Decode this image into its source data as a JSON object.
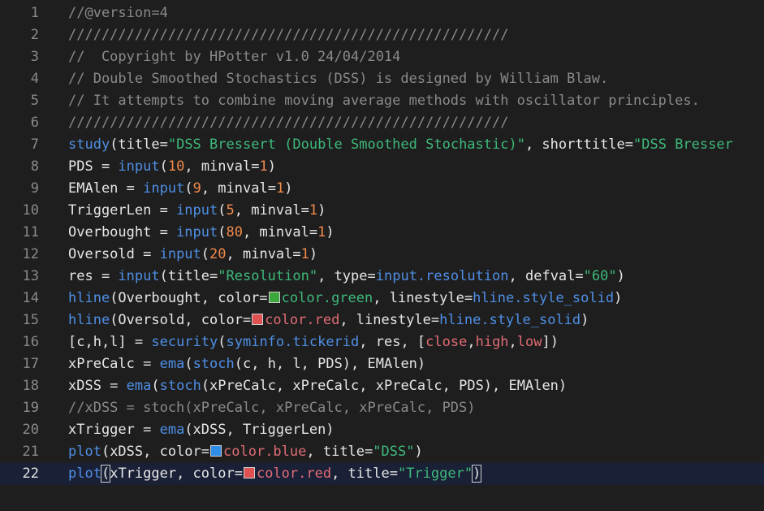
{
  "editor": {
    "active_line": 22,
    "colors": {
      "background": "#1e1e1e",
      "active_line_bg": "#1a2036",
      "comment": "#8a8a8a",
      "function": "#4f8fe6",
      "number": "#f08a4b",
      "string": "#3eb97a",
      "plain": "#e6e6e6",
      "green_swatch": "#3ca83c",
      "red_swatch": "#e05252",
      "blue_swatch": "#2f8fe8"
    },
    "lines": [
      {
        "n": "1",
        "tokens": [
          {
            "t": "comment",
            "v": "//@version=4"
          }
        ]
      },
      {
        "n": "2",
        "tokens": [
          {
            "t": "comment",
            "v": "/////////////////////////////////////////////////////"
          }
        ]
      },
      {
        "n": "3",
        "tokens": [
          {
            "t": "comment",
            "v": "//  Copyright by HPotter v1.0 24/04/2014"
          }
        ]
      },
      {
        "n": "4",
        "tokens": [
          {
            "t": "comment",
            "v": "// Double Smoothed Stochastics (DSS) is designed by William Blaw."
          }
        ]
      },
      {
        "n": "5",
        "tokens": [
          {
            "t": "comment",
            "v": "// It attempts to combine moving average methods with oscillator principles."
          }
        ]
      },
      {
        "n": "6",
        "tokens": [
          {
            "t": "comment",
            "v": "/////////////////////////////////////////////////////"
          }
        ]
      },
      {
        "n": "7",
        "tokens": [
          {
            "t": "func",
            "v": "study"
          },
          {
            "t": "plain",
            "v": "(title="
          },
          {
            "t": "str",
            "v": "\"DSS Bressert (Double Smoothed Stochastic)\""
          },
          {
            "t": "plain",
            "v": ", shorttitle="
          },
          {
            "t": "str",
            "v": "\"DSS Bresser"
          }
        ]
      },
      {
        "n": "8",
        "tokens": [
          {
            "t": "plain",
            "v": "PDS = "
          },
          {
            "t": "func",
            "v": "input"
          },
          {
            "t": "plain",
            "v": "("
          },
          {
            "t": "num",
            "v": "10"
          },
          {
            "t": "plain",
            "v": ", minval="
          },
          {
            "t": "num",
            "v": "1"
          },
          {
            "t": "plain",
            "v": ")"
          }
        ]
      },
      {
        "n": "9",
        "tokens": [
          {
            "t": "plain",
            "v": "EMAlen = "
          },
          {
            "t": "func",
            "v": "input"
          },
          {
            "t": "plain",
            "v": "("
          },
          {
            "t": "num",
            "v": "9"
          },
          {
            "t": "plain",
            "v": ", minval="
          },
          {
            "t": "num",
            "v": "1"
          },
          {
            "t": "plain",
            "v": ")"
          }
        ]
      },
      {
        "n": "10",
        "tokens": [
          {
            "t": "plain",
            "v": "TriggerLen = "
          },
          {
            "t": "func",
            "v": "input"
          },
          {
            "t": "plain",
            "v": "("
          },
          {
            "t": "num",
            "v": "5"
          },
          {
            "t": "plain",
            "v": ", minval="
          },
          {
            "t": "num",
            "v": "1"
          },
          {
            "t": "plain",
            "v": ")"
          }
        ]
      },
      {
        "n": "11",
        "tokens": [
          {
            "t": "plain",
            "v": "Overbought = "
          },
          {
            "t": "func",
            "v": "input"
          },
          {
            "t": "plain",
            "v": "("
          },
          {
            "t": "num",
            "v": "80"
          },
          {
            "t": "plain",
            "v": ", minval="
          },
          {
            "t": "num",
            "v": "1"
          },
          {
            "t": "plain",
            "v": ")"
          }
        ]
      },
      {
        "n": "12",
        "tokens": [
          {
            "t": "plain",
            "v": "Oversold = "
          },
          {
            "t": "func",
            "v": "input"
          },
          {
            "t": "plain",
            "v": "("
          },
          {
            "t": "num",
            "v": "20"
          },
          {
            "t": "plain",
            "v": ", minval="
          },
          {
            "t": "num",
            "v": "1"
          },
          {
            "t": "plain",
            "v": ")"
          }
        ]
      },
      {
        "n": "13",
        "tokens": [
          {
            "t": "plain",
            "v": "res = "
          },
          {
            "t": "func",
            "v": "input"
          },
          {
            "t": "plain",
            "v": "(title="
          },
          {
            "t": "str",
            "v": "\"Resolution\""
          },
          {
            "t": "plain",
            "v": ", type="
          },
          {
            "t": "func",
            "v": "input.resolution"
          },
          {
            "t": "plain",
            "v": ", defval="
          },
          {
            "t": "str",
            "v": "\"60\""
          },
          {
            "t": "plain",
            "v": ")"
          }
        ]
      },
      {
        "n": "14",
        "tokens": [
          {
            "t": "func",
            "v": "hline"
          },
          {
            "t": "plain",
            "v": "(Overbought, color="
          },
          {
            "t": "swatch",
            "v": "green_swatch"
          },
          {
            "t": "str",
            "v": "color.green"
          },
          {
            "t": "plain",
            "v": ", linestyle="
          },
          {
            "t": "func",
            "v": "hline.style_solid"
          },
          {
            "t": "plain",
            "v": ")"
          }
        ]
      },
      {
        "n": "15",
        "tokens": [
          {
            "t": "func",
            "v": "hline"
          },
          {
            "t": "plain",
            "v": "(Oversold, color="
          },
          {
            "t": "swatch",
            "v": "red_swatch"
          },
          {
            "t": "name",
            "v": "color.red"
          },
          {
            "t": "plain",
            "v": ", linestyle="
          },
          {
            "t": "func",
            "v": "hline.style_solid"
          },
          {
            "t": "plain",
            "v": ")"
          }
        ]
      },
      {
        "n": "16",
        "tokens": [
          {
            "t": "plain",
            "v": "[c,h,l] = "
          },
          {
            "t": "func",
            "v": "security"
          },
          {
            "t": "plain",
            "v": "("
          },
          {
            "t": "func",
            "v": "syminfo.tickerid"
          },
          {
            "t": "plain",
            "v": ", res, ["
          },
          {
            "t": "name",
            "v": "close"
          },
          {
            "t": "plain",
            "v": ","
          },
          {
            "t": "name",
            "v": "high"
          },
          {
            "t": "plain",
            "v": ","
          },
          {
            "t": "name",
            "v": "low"
          },
          {
            "t": "plain",
            "v": "])"
          }
        ]
      },
      {
        "n": "17",
        "tokens": [
          {
            "t": "plain",
            "v": "xPreCalc = "
          },
          {
            "t": "func",
            "v": "ema"
          },
          {
            "t": "plain",
            "v": "("
          },
          {
            "t": "func",
            "v": "stoch"
          },
          {
            "t": "plain",
            "v": "(c, h, l, PDS), EMAlen)"
          }
        ]
      },
      {
        "n": "18",
        "tokens": [
          {
            "t": "plain",
            "v": "xDSS = "
          },
          {
            "t": "func",
            "v": "ema"
          },
          {
            "t": "plain",
            "v": "("
          },
          {
            "t": "func",
            "v": "stoch"
          },
          {
            "t": "plain",
            "v": "(xPreCalc, xPreCalc, xPreCalc, PDS), EMAlen)"
          }
        ]
      },
      {
        "n": "19",
        "tokens": [
          {
            "t": "comment",
            "v": "//xDSS = stoch(xPreCalc, xPreCalc, xPreCalc, PDS)"
          }
        ]
      },
      {
        "n": "20",
        "tokens": [
          {
            "t": "plain",
            "v": "xTrigger = "
          },
          {
            "t": "func",
            "v": "ema"
          },
          {
            "t": "plain",
            "v": "(xDSS, TriggerLen)"
          }
        ]
      },
      {
        "n": "21",
        "tokens": [
          {
            "t": "func",
            "v": "plot"
          },
          {
            "t": "plain",
            "v": "(xDSS, color="
          },
          {
            "t": "swatch",
            "v": "blue_swatch"
          },
          {
            "t": "name",
            "v": "color.blue"
          },
          {
            "t": "plain",
            "v": ", title="
          },
          {
            "t": "str",
            "v": "\"DSS\""
          },
          {
            "t": "plain",
            "v": ")"
          }
        ]
      },
      {
        "n": "22",
        "tokens": [
          {
            "t": "func",
            "v": "plot"
          },
          {
            "t": "bracket",
            "v": "("
          },
          {
            "t": "plain",
            "v": "xTrigger, color="
          },
          {
            "t": "swatch",
            "v": "red_swatch"
          },
          {
            "t": "name",
            "v": "color.red"
          },
          {
            "t": "plain",
            "v": ", title="
          },
          {
            "t": "str",
            "v": "\"Trigger\""
          },
          {
            "t": "bracket",
            "v": ")"
          }
        ]
      }
    ]
  }
}
